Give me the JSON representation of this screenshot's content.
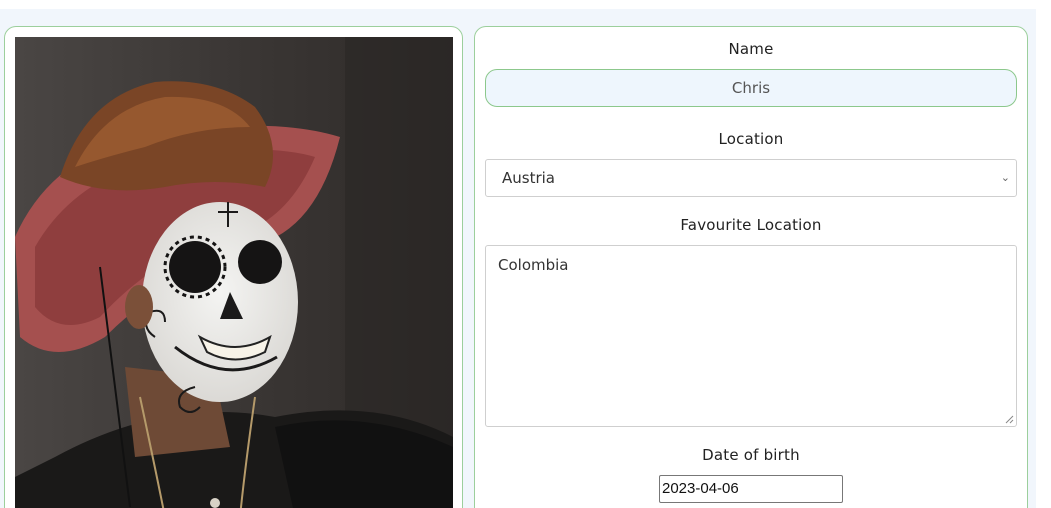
{
  "profile": {
    "photo_alt": "photo",
    "name_label": "Name",
    "name_value": "Chris",
    "location_label": "Location",
    "location_value": "Austria",
    "favourite_label": "Favourite Location",
    "favourite_value": "Colombia",
    "dob_label": "Date of birth",
    "dob_value": "2023-04-06"
  },
  "icons": {
    "select_arrow": "chevron-down-icon",
    "resize": "resize-grip-icon"
  },
  "colors": {
    "card_border": "#9ccf9c",
    "input_fill": "#eef6fd",
    "page_bg": "#f1f6fc"
  }
}
